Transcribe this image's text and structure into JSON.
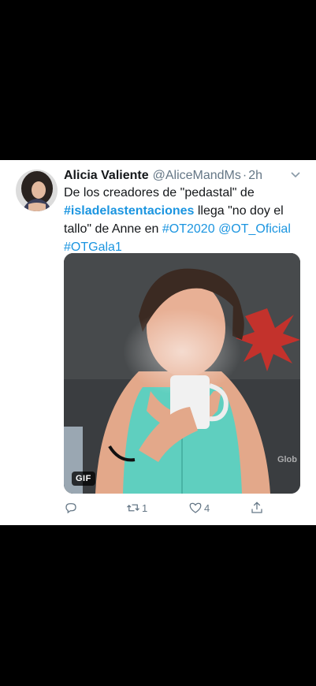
{
  "tweet": {
    "display_name": "Alicia Valiente",
    "handle": "@AliceMandMs",
    "separator": "·",
    "time": "2h",
    "text_parts": {
      "p1": "De los creadores de \"pedastal\" de ",
      "h1": "#isladelastentaciones",
      "p2": " llega \"no doy el tallo\" de Anne en ",
      "h2": "#OT2020",
      "p3": " ",
      "h3": "@OT_Oficial",
      "p4": " ",
      "h4": "#OTGala1"
    },
    "media": {
      "badge": "GIF",
      "watermark": "Glob"
    },
    "actions": {
      "reply_icon": "reply-icon",
      "retweet_count": "1",
      "like_count": "4",
      "share_icon": "share-icon"
    }
  },
  "colors": {
    "link": "#1b95e0",
    "secondary_text": "#657786",
    "primary_text": "#14171a",
    "background": "#000000"
  }
}
